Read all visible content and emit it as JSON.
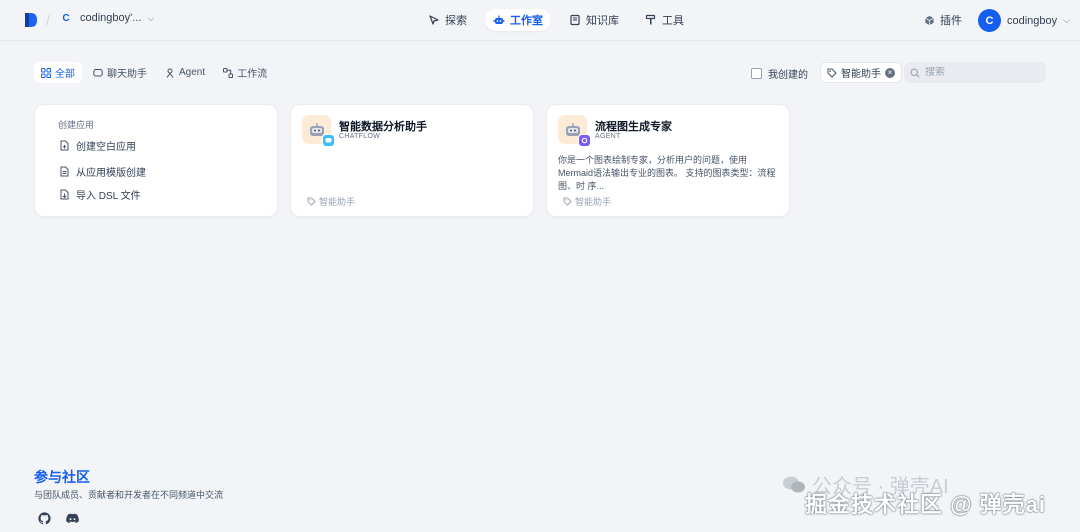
{
  "header": {
    "workspace_initial": "C",
    "workspace_name": "codingboy'...",
    "nav": [
      {
        "label": "探索",
        "icon": "explore-icon"
      },
      {
        "label": "工作室",
        "icon": "robot-icon",
        "active": true
      },
      {
        "label": "知识库",
        "icon": "book-icon"
      },
      {
        "label": "工具",
        "icon": "hammer-icon"
      }
    ],
    "plugins_label": "插件",
    "user_initial": "C",
    "user_name": "codingboy"
  },
  "filters": {
    "tabs": [
      {
        "label": "全部",
        "icon": "grid-icon",
        "active": true
      },
      {
        "label": "聊天助手",
        "icon": "chat-icon"
      },
      {
        "label": "Agent",
        "icon": "agent-icon"
      },
      {
        "label": "工作流",
        "icon": "workflow-icon"
      }
    ],
    "mine_label": "我创建的",
    "tag_label": "智能助手",
    "search_placeholder": "搜索"
  },
  "create_card": {
    "title": "创建应用",
    "items": [
      {
        "label": "创建空白应用",
        "icon": "file-plus-icon"
      },
      {
        "label": "从应用模版创建",
        "icon": "template-icon"
      },
      {
        "label": "导入 DSL 文件",
        "icon": "import-icon"
      }
    ]
  },
  "apps": [
    {
      "name": "智能数据分析助手",
      "type": "CHATFLOW",
      "description": "",
      "tag": "智能助手",
      "badge_color": "#36bffa"
    },
    {
      "name": "流程图生成专家",
      "type": "AGENT",
      "description": "你是一个图表绘制专家，分析用户的问题，使用Mermaid语法输出专业的图表。 支持的图表类型：流程图、时 序...",
      "tag": "智能助手",
      "badge_color": "#7a5af8"
    }
  ],
  "footer": {
    "community_title": "参与社区",
    "community_desc": "与团队成员、贡献者和开发者在不同频道中交流",
    "icons": [
      "github-icon",
      "discord-icon"
    ]
  },
  "watermark": {
    "line1": "公众号 · 弹壳AI",
    "line2": "掘金技术社区 @ 弹壳ai"
  },
  "colors": {
    "accent": "#155eef",
    "background": "#f2f4f7"
  }
}
